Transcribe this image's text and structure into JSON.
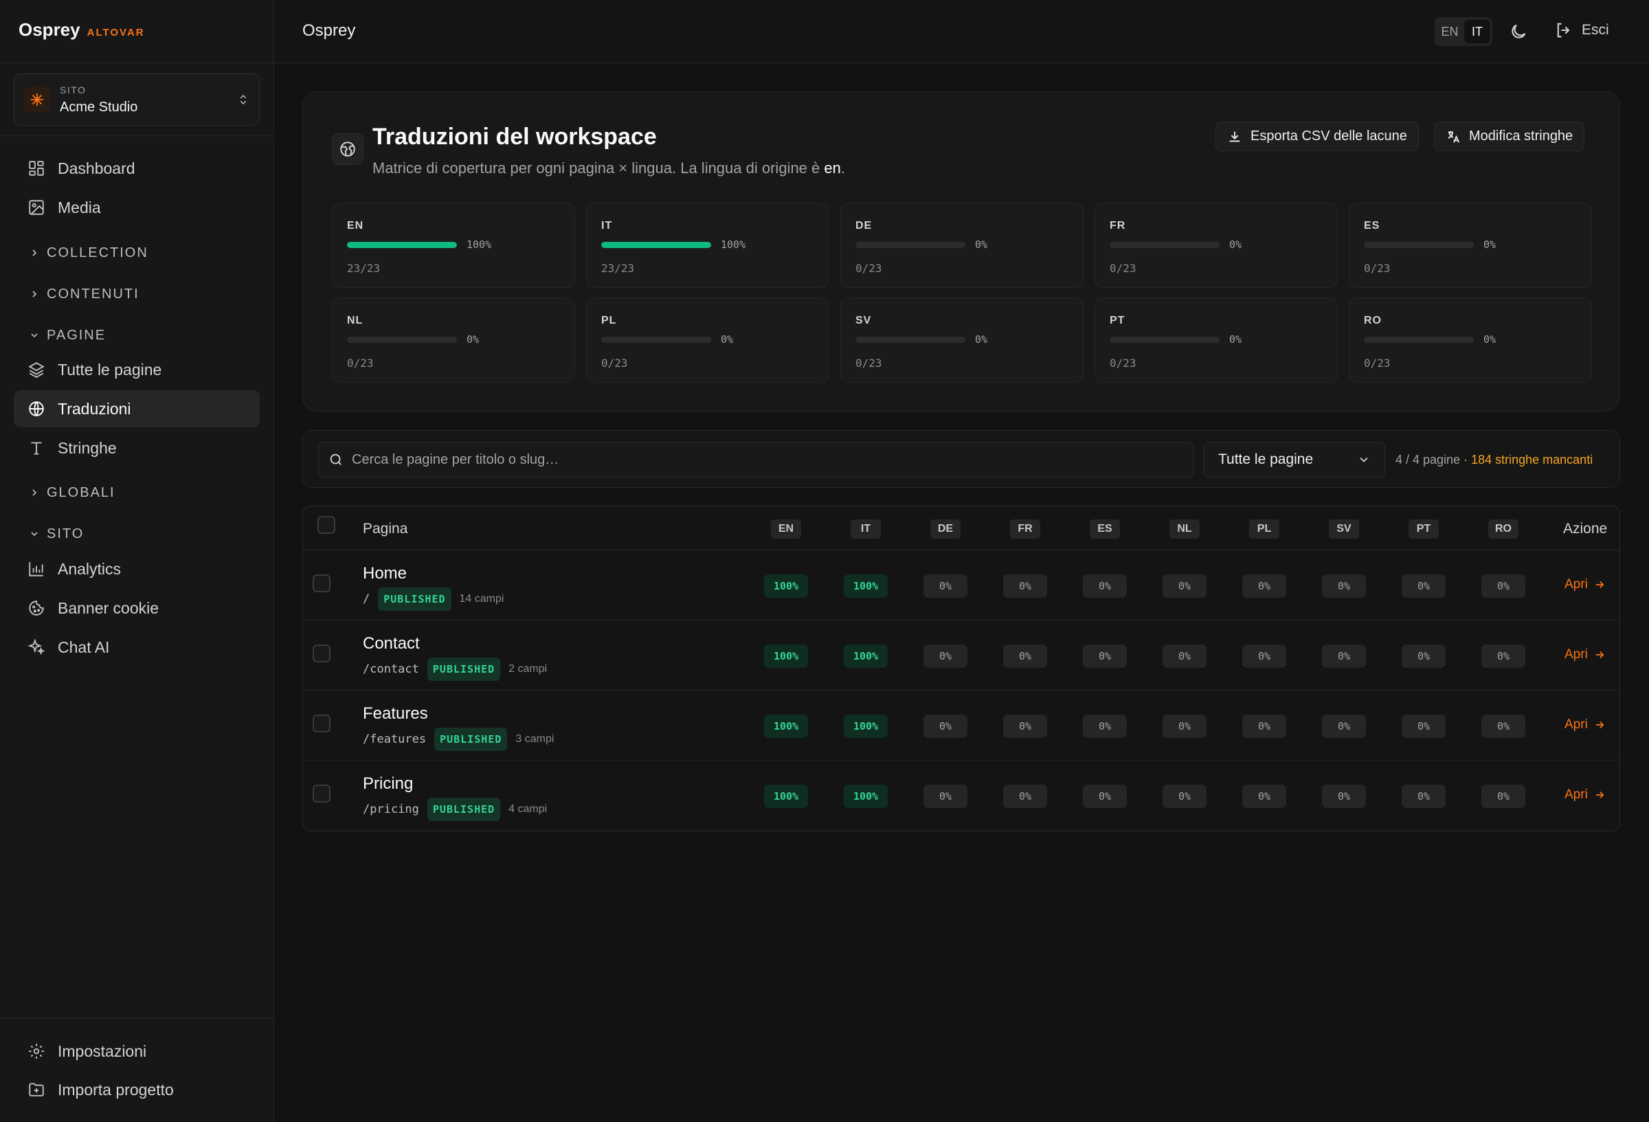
{
  "app": {
    "brand": "Osprey",
    "brand_tag": "ALTOVAR",
    "topbar_title": "Osprey"
  },
  "site_switcher": {
    "label": "SITO",
    "name": "Acme Studio"
  },
  "sidebar": {
    "dashboard": "Dashboard",
    "media": "Media",
    "collection": "COLLECTION",
    "contenuti": "CONTENUTI",
    "pagine": "PAGINE",
    "tutte_le_pagine": "Tutte le pagine",
    "traduzioni": "Traduzioni",
    "stringhe": "Stringhe",
    "globali": "GLOBALI",
    "sito": "SITO",
    "analytics": "Analytics",
    "banner_cookie": "Banner cookie",
    "chat_ai": "Chat AI",
    "impostazioni": "Impostazioni",
    "importa_progetto": "Importa progetto"
  },
  "topbar": {
    "lang_en": "EN",
    "lang_it": "IT",
    "active_lang": "IT",
    "logout": "Esci"
  },
  "panel": {
    "title": "Traduzioni del workspace",
    "subtitle_prefix": "Matrice di copertura per ogni pagina × lingua. La lingua di origine è ",
    "source_lang": "en",
    "subtitle_suffix": ".",
    "export_button": "Esporta CSV delle lacune",
    "edit_button": "Modifica stringhe"
  },
  "coverage": [
    {
      "code": "EN",
      "percent": 100,
      "pct_label": "100%",
      "count": "23/23"
    },
    {
      "code": "IT",
      "percent": 100,
      "pct_label": "100%",
      "count": "23/23"
    },
    {
      "code": "DE",
      "percent": 0,
      "pct_label": "0%",
      "count": "0/23"
    },
    {
      "code": "FR",
      "percent": 0,
      "pct_label": "0%",
      "count": "0/23"
    },
    {
      "code": "ES",
      "percent": 0,
      "pct_label": "0%",
      "count": "0/23"
    },
    {
      "code": "NL",
      "percent": 0,
      "pct_label": "0%",
      "count": "0/23"
    },
    {
      "code": "PL",
      "percent": 0,
      "pct_label": "0%",
      "count": "0/23"
    },
    {
      "code": "SV",
      "percent": 0,
      "pct_label": "0%",
      "count": "0/23"
    },
    {
      "code": "PT",
      "percent": 0,
      "pct_label": "0%",
      "count": "0/23"
    },
    {
      "code": "RO",
      "percent": 0,
      "pct_label": "0%",
      "count": "0/23"
    }
  ],
  "filters": {
    "search_placeholder": "Cerca le pagine per titolo o slug…",
    "search_value": "",
    "select_value": "Tutte le pagine",
    "count_text": "4 / 4 pagine",
    "missing_text": "· 184 stringhe mancanti"
  },
  "table": {
    "col_page": "Pagina",
    "col_action": "Azione",
    "languages": [
      "EN",
      "IT",
      "DE",
      "FR",
      "ES",
      "NL",
      "PL",
      "SV",
      "PT",
      "RO"
    ],
    "rows": [
      {
        "title": "Home",
        "slug": "/",
        "status": "PUBLISHED",
        "fields": "14 campi",
        "values": [
          "100%",
          "100%",
          "0%",
          "0%",
          "0%",
          "0%",
          "0%",
          "0%",
          "0%",
          "0%"
        ],
        "action": "Apri"
      },
      {
        "title": "Contact",
        "slug": "/contact",
        "status": "PUBLISHED",
        "fields": "2 campi",
        "values": [
          "100%",
          "100%",
          "0%",
          "0%",
          "0%",
          "0%",
          "0%",
          "0%",
          "0%",
          "0%"
        ],
        "action": "Apri"
      },
      {
        "title": "Features",
        "slug": "/features",
        "status": "PUBLISHED",
        "fields": "3 campi",
        "values": [
          "100%",
          "100%",
          "0%",
          "0%",
          "0%",
          "0%",
          "0%",
          "0%",
          "0%",
          "0%"
        ],
        "action": "Apri"
      },
      {
        "title": "Pricing",
        "slug": "/pricing",
        "status": "PUBLISHED",
        "fields": "4 campi",
        "values": [
          "100%",
          "100%",
          "0%",
          "0%",
          "0%",
          "0%",
          "0%",
          "0%",
          "0%",
          "0%"
        ],
        "action": "Apri"
      }
    ]
  },
  "colors": {
    "accent": "#f97316",
    "success": "#10b981",
    "warning": "#f5a524",
    "background": "#121212"
  },
  "icons": {
    "dashboard": "grid-icon",
    "media": "image-icon",
    "pages": "layers-icon",
    "translations": "globe-icon",
    "strings": "type-icon",
    "analytics": "bar-chart-icon",
    "cookie": "cookie-icon",
    "ai": "sparkles-icon",
    "settings": "gear-icon",
    "import": "folder-plus-icon"
  }
}
